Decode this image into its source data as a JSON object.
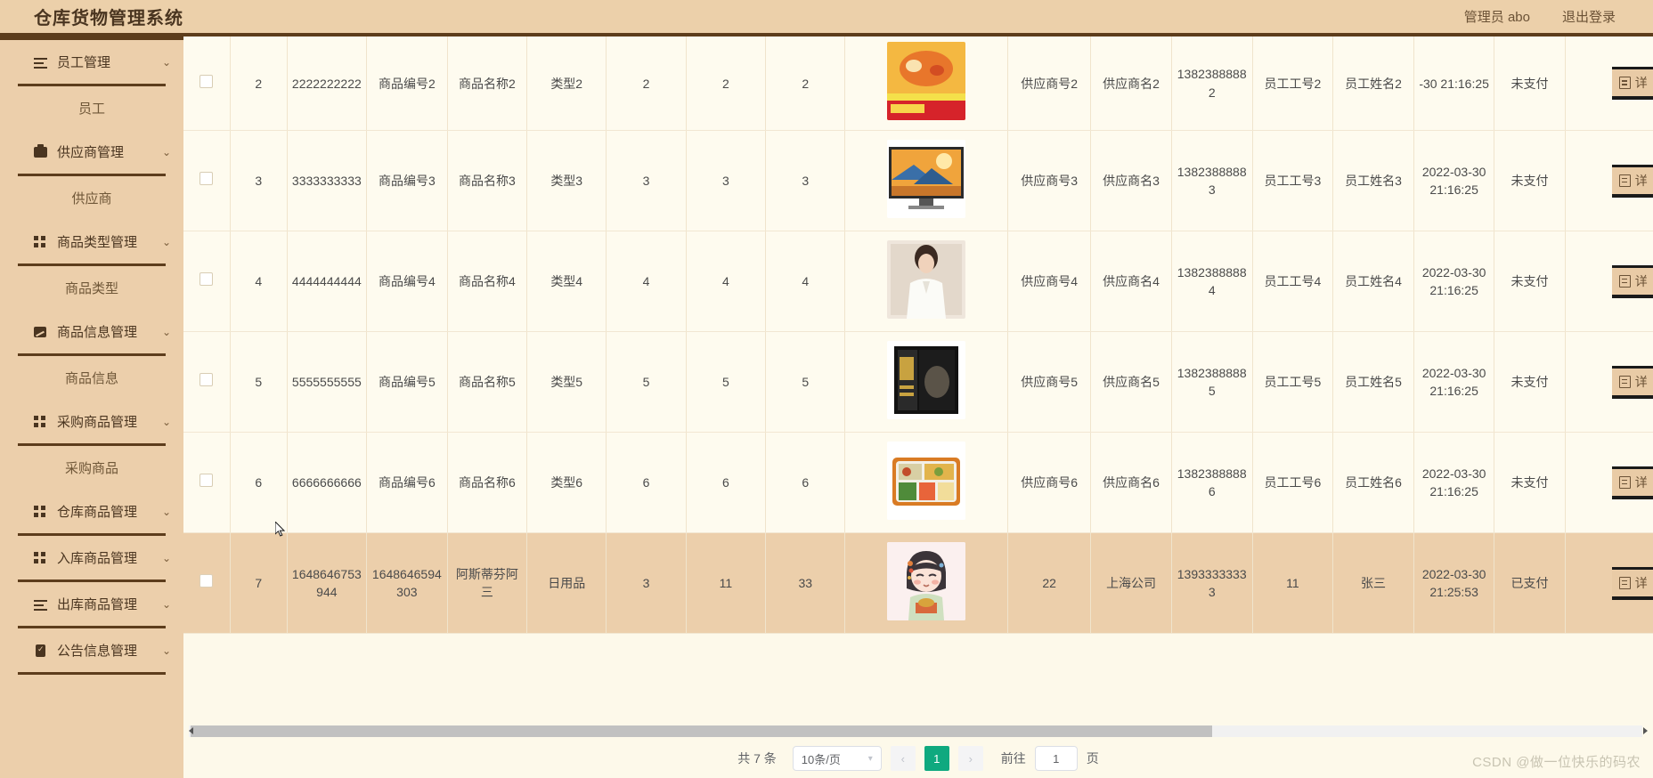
{
  "header": {
    "brand": "仓库货物管理系统",
    "user_label": "管理员 abo",
    "logout_label": "退出登录"
  },
  "sidebar": {
    "groups": [
      {
        "icon": "list-icon",
        "label": "员工管理",
        "arrow": "⌄",
        "child": "员工"
      },
      {
        "icon": "box-icon",
        "label": "供应商管理",
        "arrow": "⌄",
        "child": "供应商"
      },
      {
        "icon": "grid-icon",
        "label": "商品类型管理",
        "arrow": "⌄",
        "child": "商品类型"
      },
      {
        "icon": "chart-icon",
        "label": "商品信息管理",
        "arrow": "⌄",
        "child": "商品信息"
      },
      {
        "icon": "grid-icon",
        "label": "采购商品管理",
        "arrow": "⌄",
        "child": "采购商品"
      },
      {
        "icon": "grid-icon",
        "label": "仓库商品管理",
        "arrow": "⌄",
        "child": null
      },
      {
        "icon": "grid-icon",
        "label": "入库商品管理",
        "arrow": "⌄",
        "child": null
      },
      {
        "icon": "list-icon",
        "label": "出库商品管理",
        "arrow": "⌄",
        "child": null
      },
      {
        "icon": "clipboard-icon",
        "label": "公告信息管理",
        "arrow": "⌄",
        "child": null
      }
    ]
  },
  "table": {
    "action_label": "详",
    "rows": [
      {
        "index": "2",
        "long_no": "2222222222",
        "code": "商品编号2",
        "name": "商品名称2",
        "type": "类型2",
        "n1": "2",
        "n2": "2",
        "n3": "2",
        "image": "food-promo",
        "supplier_no": "供应商号2",
        "supplier_name": "供应商名2",
        "tel": "13823888882",
        "emp_no": "员工工号2",
        "emp_name": "员工姓名2",
        "date": "-30 21:16:25",
        "pay": "未支付",
        "highlight": false,
        "clipped_top": true
      },
      {
        "index": "3",
        "long_no": "3333333333",
        "code": "商品编号3",
        "name": "商品名称3",
        "type": "类型3",
        "n1": "3",
        "n2": "3",
        "n3": "3",
        "image": "tv-sunset",
        "supplier_no": "供应商号3",
        "supplier_name": "供应商名3",
        "tel": "13823888883",
        "emp_no": "员工工号3",
        "emp_name": "员工姓名3",
        "date": "2022-03-30 21:16:25",
        "pay": "未支付",
        "highlight": false,
        "clipped_top": false
      },
      {
        "index": "4",
        "long_no": "4444444444",
        "code": "商品编号4",
        "name": "商品名称4",
        "type": "类型4",
        "n1": "4",
        "n2": "4",
        "n3": "4",
        "image": "woman-blouse",
        "supplier_no": "供应商号4",
        "supplier_name": "供应商名4",
        "tel": "13823888884",
        "emp_no": "员工工号4",
        "emp_name": "员工姓名4",
        "date": "2022-03-30 21:16:25",
        "pay": "未支付",
        "highlight": false,
        "clipped_top": false
      },
      {
        "index": "5",
        "long_no": "5555555555",
        "code": "商品编号5",
        "name": "商品名称5",
        "type": "类型5",
        "n1": "5",
        "n2": "5",
        "n3": "5",
        "image": "book-set",
        "supplier_no": "供应商号5",
        "supplier_name": "供应商名5",
        "tel": "13823888885",
        "emp_no": "员工工号5",
        "emp_name": "员工姓名5",
        "date": "2022-03-30 21:16:25",
        "pay": "未支付",
        "highlight": false,
        "clipped_top": false
      },
      {
        "index": "6",
        "long_no": "6666666666",
        "code": "商品编号6",
        "name": "商品名称6",
        "type": "类型6",
        "n1": "6",
        "n2": "6",
        "n3": "6",
        "image": "bento-box",
        "supplier_no": "供应商号6",
        "supplier_name": "供应商名6",
        "tel": "13823888886",
        "emp_no": "员工工号6",
        "emp_name": "员工姓名6",
        "date": "2022-03-30 21:16:25",
        "pay": "未支付",
        "highlight": false,
        "clipped_top": false
      },
      {
        "index": "7",
        "long_no": "1648646753944",
        "code": "1648646594303",
        "name": "阿斯蒂芬阿三",
        "type": "日用品",
        "n1": "3",
        "n2": "11",
        "n3": "33",
        "image": "anime-girl",
        "supplier_no": "22",
        "supplier_name": "上海公司",
        "tel": "13933333333",
        "emp_no": "11",
        "emp_name": "张三",
        "date": "2022-03-30 21:25:53",
        "pay": "已支付",
        "highlight": true,
        "clipped_top": false
      }
    ]
  },
  "pagination": {
    "total": "共 7 条",
    "page_size": "10条/页",
    "prev": "‹",
    "current_page": "1",
    "next": "›",
    "jump_label": "前往",
    "jump_value": "1",
    "page_unit": "页"
  },
  "watermark": "CSDN @做一位快乐的码农"
}
